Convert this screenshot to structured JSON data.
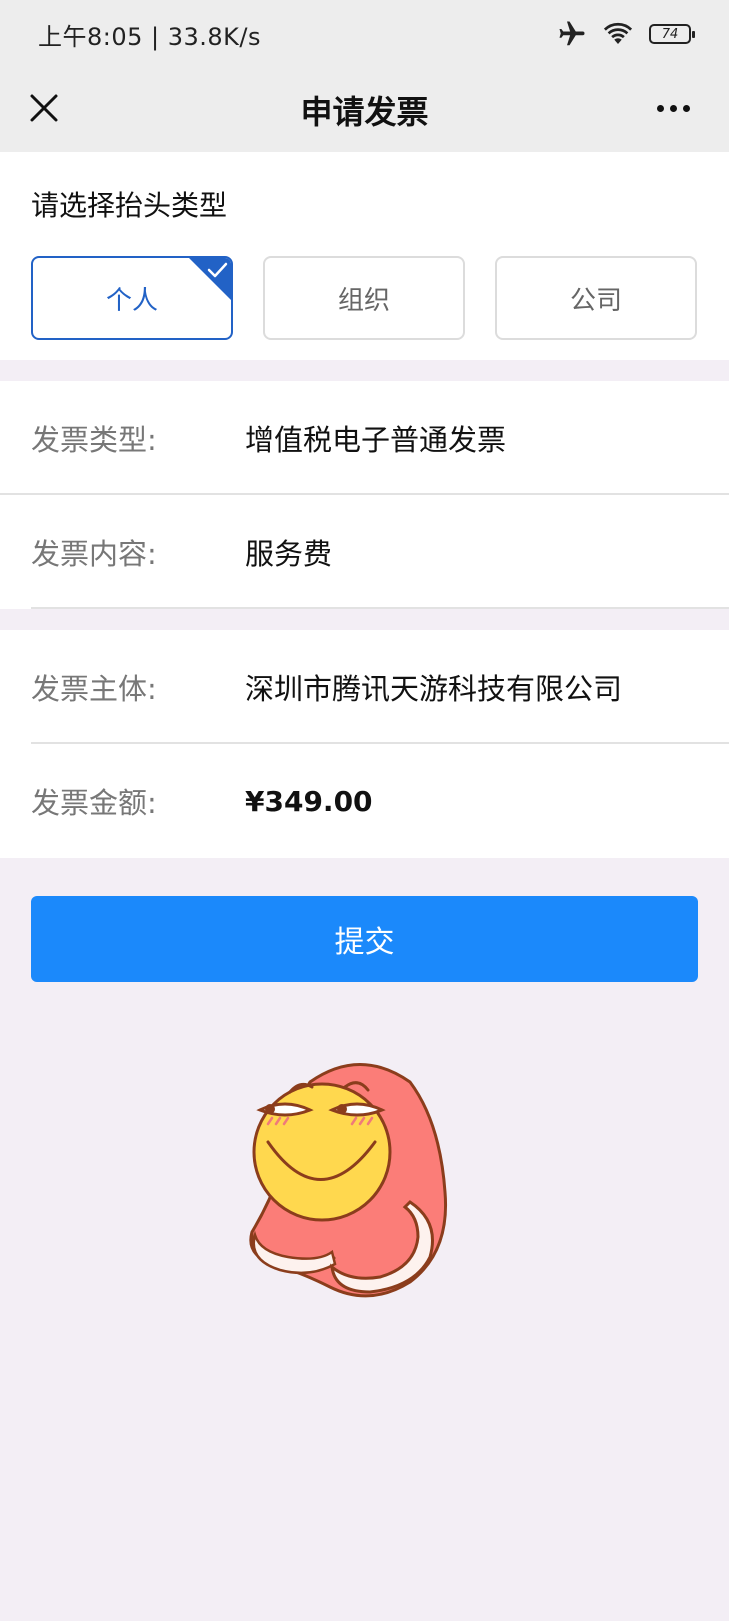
{
  "status_bar": {
    "time_speed": "上午8:05 | 33.8K/s",
    "battery": "74",
    "icons": [
      "airplane-icon",
      "wifi-icon",
      "battery-icon"
    ]
  },
  "nav": {
    "title": "申请发票",
    "close_icon": "close-icon",
    "more_icon": "more-icon"
  },
  "header_type": {
    "label": "请选择抬头类型",
    "options": [
      {
        "label": "个人",
        "selected": true
      },
      {
        "label": "组织",
        "selected": false
      },
      {
        "label": "公司",
        "selected": false
      }
    ]
  },
  "invoice": {
    "type_label": "发票类型:",
    "type_value": "增值税电子普通发票",
    "content_label": "发票内容:",
    "content_value": "服务费",
    "entity_label": "发票主体:",
    "entity_value": "深圳市腾讯天游科技有限公司",
    "amount_label": "发票金额:",
    "amount_value": "¥349.00"
  },
  "submit_label": "提交",
  "colors": {
    "accent": "#1b89fb",
    "selected_border": "#2262c6",
    "background": "#f3eef5"
  },
  "sticker": "smiley-blanket-sticker"
}
